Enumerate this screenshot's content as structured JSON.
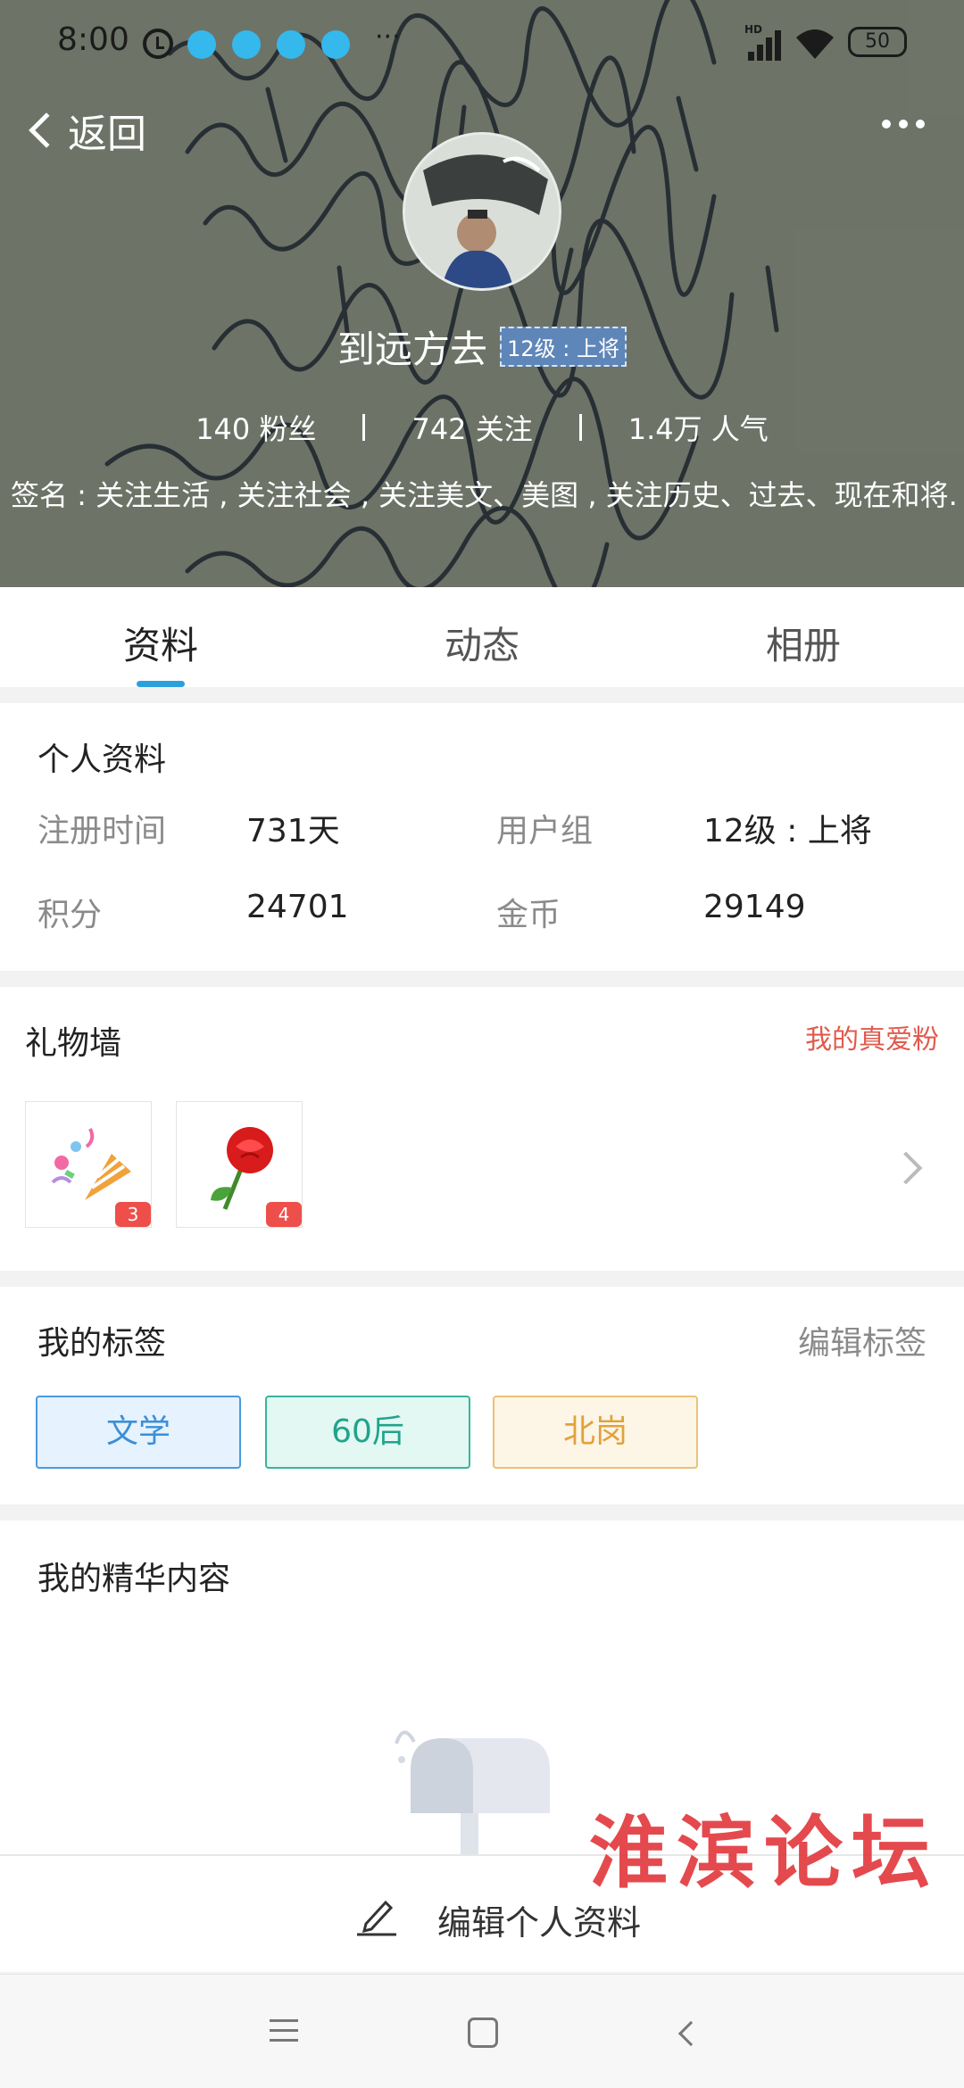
{
  "status_bar": {
    "time": "8:00",
    "more": "···",
    "network": "HD",
    "battery": "50"
  },
  "header": {
    "back_label": "返回",
    "name": "到远方去",
    "level_badge": "12级 : 上将",
    "stats": [
      {
        "value": "140",
        "label": "粉丝"
      },
      {
        "value": "742",
        "label": "关注"
      },
      {
        "value": "1.4万",
        "label": "人气"
      }
    ],
    "signature": "签名 : 关注生活 , 关注社会 , 关注美文、美图 , 关注历史、过去、现在和将..."
  },
  "tabs": [
    "资料",
    "动态",
    "相册"
  ],
  "profile": {
    "title": "个人资料",
    "fields": [
      {
        "label": "注册时间",
        "value": "731天"
      },
      {
        "label": "用户组",
        "value": "12级 : 上将"
      },
      {
        "label": "积分",
        "value": "24701"
      },
      {
        "label": "金币",
        "value": "29149"
      }
    ]
  },
  "gift_wall": {
    "title": "礼物墙",
    "fan_link": "我的真爱粉",
    "gifts": [
      {
        "icon": "party-popper-icon",
        "count": "3"
      },
      {
        "icon": "rose-icon",
        "count": "4"
      }
    ]
  },
  "tags_section": {
    "title": "我的标签",
    "edit": "编辑标签",
    "tags": [
      {
        "label": "文学",
        "color": "#3a8fd8",
        "bg": "#e6f2fd",
        "border": "#4a9ae0"
      },
      {
        "label": "60后",
        "color": "#1fa48a",
        "bg": "#e3f7f3",
        "border": "#38b59c"
      },
      {
        "label": "北岗",
        "color": "#e2a13c",
        "bg": "#fdf5e5",
        "border": "#ecc174"
      }
    ]
  },
  "essence": {
    "title": "我的精华内容"
  },
  "bottom_action": {
    "edit_profile": "编辑个人资料"
  },
  "watermark": "淮滨论坛",
  "colors": {
    "accent": "#2ca0dd",
    "link_red": "#e15a4e"
  }
}
